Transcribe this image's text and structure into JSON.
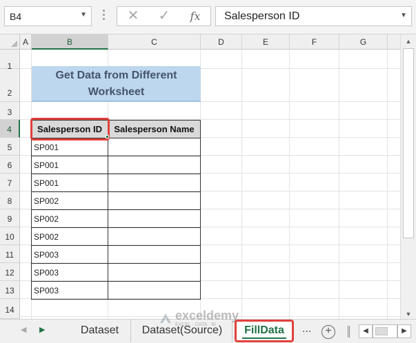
{
  "formula_bar": {
    "name_box": "B4",
    "cancel_symbol": "✕",
    "enter_symbol": "✓",
    "fx_label": "fx",
    "formula_value": "Salesperson ID"
  },
  "columns": [
    "A",
    "B",
    "C",
    "D",
    "E",
    "F",
    "G"
  ],
  "selected_column": "B",
  "rows": [
    "1",
    "2",
    "3",
    "4",
    "5",
    "6",
    "7",
    "8",
    "9",
    "10",
    "11",
    "12",
    "13",
    "14"
  ],
  "selected_row": "4",
  "sheet": {
    "title": "Get Data from Different Worksheet",
    "headers": [
      "Salesperson ID",
      "Salesperson Name"
    ],
    "records": [
      {
        "id": "SP001",
        "name": ""
      },
      {
        "id": "SP001",
        "name": ""
      },
      {
        "id": "SP001",
        "name": ""
      },
      {
        "id": "SP002",
        "name": ""
      },
      {
        "id": "SP002",
        "name": ""
      },
      {
        "id": "SP002",
        "name": ""
      },
      {
        "id": "SP003",
        "name": ""
      },
      {
        "id": "SP003",
        "name": ""
      },
      {
        "id": "SP003",
        "name": ""
      }
    ]
  },
  "tabs": {
    "items": [
      "Dataset",
      "Dataset(Source)",
      "FillData"
    ],
    "active": "FillData",
    "more": "...",
    "add": "+"
  },
  "watermark": {
    "name": "exceldemy",
    "tagline": "EXCEL · DATA · BI"
  },
  "colors": {
    "accent_green": "#217346",
    "highlight_red": "#e0403c",
    "title_fill": "#bdd7ee",
    "title_text": "#44546a",
    "header_fill": "#d9d9d9"
  }
}
